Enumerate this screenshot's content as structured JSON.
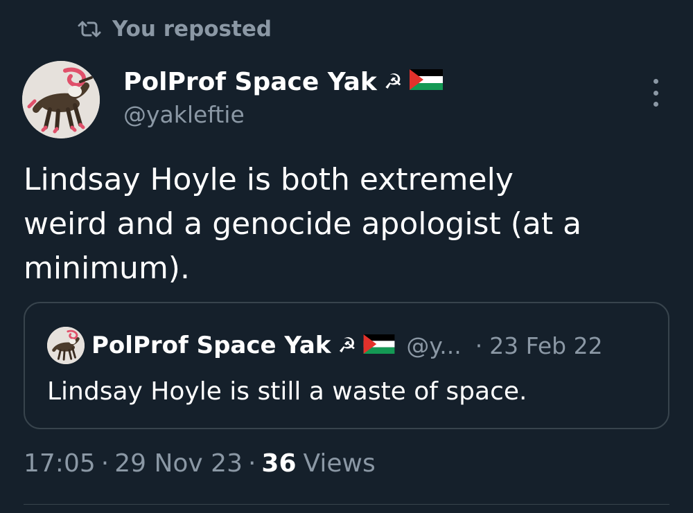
{
  "repost": {
    "label": "You reposted"
  },
  "author": {
    "name": "PolProf Space Yak",
    "emoji": "☭",
    "handle": "@yakleftie"
  },
  "tweet": {
    "text": "Lindsay Hoyle is both extremely\nweird and a genocide apologist (at a\nminimum)."
  },
  "quote": {
    "name": "PolProf Space Yak",
    "emoji": "☭",
    "handle": "@y...",
    "separator": "·",
    "date": "23 Feb 22",
    "text": "Lindsay Hoyle is still a waste of space."
  },
  "meta": {
    "time": "17:05",
    "separator": "·",
    "date": "29 Nov 23",
    "views_count": "36",
    "views_label": "Views"
  },
  "icons": {
    "repost": "repost-icon",
    "more": "more-vertical-icon",
    "flag": "palestine-flag-icon"
  },
  "colors": {
    "background": "#15202b",
    "secondary_text": "#8b98a5",
    "border": "#38444d",
    "flag_black": "#000000",
    "flag_white": "#ffffff",
    "flag_green": "#149954",
    "flag_red": "#e4312b"
  }
}
